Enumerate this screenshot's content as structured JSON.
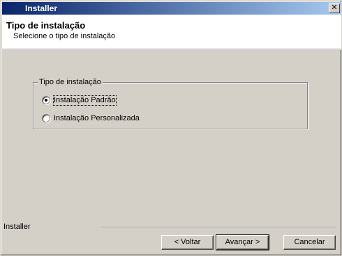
{
  "window": {
    "title": "Installer",
    "close_glyph": "✕"
  },
  "header": {
    "title": "Tipo de instalação",
    "subtitle": "Selecione o tipo de instalação"
  },
  "group": {
    "label": "Tipo de instalação",
    "options": [
      {
        "label": "Instalação Padrão",
        "checked": true
      },
      {
        "label": "Instalação Personalizada",
        "checked": false
      }
    ]
  },
  "footer": {
    "label": "Installer",
    "back_label": "< Voltar",
    "next_label": "Avançar >",
    "cancel_label": "Cancelar"
  },
  "colors": {
    "title_gradient_start": "#0a246a",
    "title_gradient_end": "#a6caf0",
    "dialog_face": "#d4d0c8",
    "header_bg": "#ffffff"
  }
}
